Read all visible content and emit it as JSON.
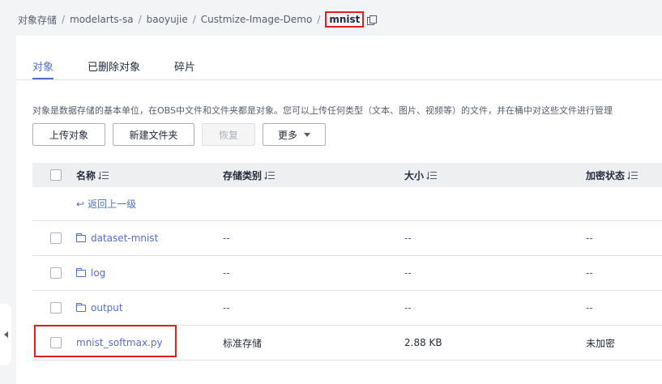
{
  "breadcrumb": {
    "items": [
      "对象存储",
      "modelarts-sa",
      "baoyujie",
      "Custmize-Image-Demo"
    ],
    "current": "mnist",
    "separator": "/"
  },
  "tabs": [
    {
      "label": "对象",
      "active": true
    },
    {
      "label": "已删除对象",
      "active": false
    },
    {
      "label": "碎片",
      "active": false
    }
  ],
  "description": "对象是数据存储的基本单位，在OBS中文件和文件夹都是对象。您可以上传任何类型（文本、图片、视频等）的文件，并在桶中对这些文件进行管理",
  "toolbar": {
    "upload_label": "上传对象",
    "new_folder_label": "新建文件夹",
    "restore_label": "恢复",
    "more_label": "更多"
  },
  "table": {
    "columns": {
      "name": "名称",
      "storage_class": "存储类别",
      "size": "大小",
      "encryption": "加密状态"
    },
    "back_label": "返回上一级",
    "rows": [
      {
        "name": "dataset-mnist",
        "type": "folder",
        "storage_class": "--",
        "size": "--",
        "encryption": "--"
      },
      {
        "name": "log",
        "type": "folder",
        "storage_class": "--",
        "size": "--",
        "encryption": "--"
      },
      {
        "name": "output",
        "type": "folder",
        "storage_class": "--",
        "size": "--",
        "encryption": "--"
      },
      {
        "name": "mnist_softmax.py",
        "type": "file",
        "storage_class": "标准存储",
        "size": "2.88 KB",
        "encryption": "未加密"
      }
    ]
  },
  "colors": {
    "accent": "#526ecc",
    "highlight": "#e02020",
    "background": "#f3f4f6"
  }
}
